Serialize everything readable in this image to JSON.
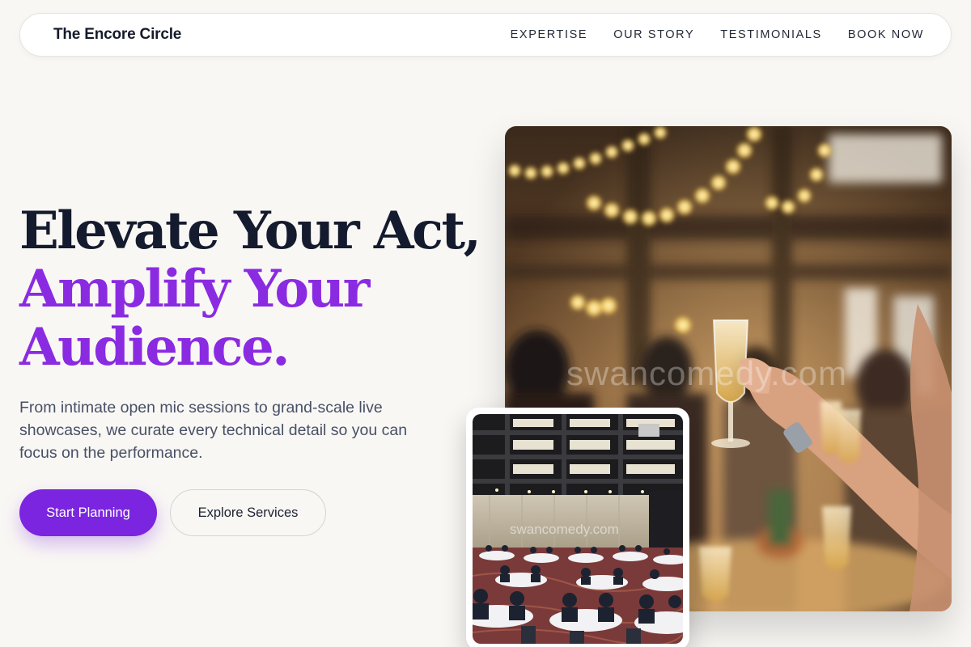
{
  "header": {
    "brand": "The Encore Circle",
    "nav": [
      {
        "label": "EXPERTISE"
      },
      {
        "label": "OUR STORY"
      },
      {
        "label": "TESTIMONIALS"
      },
      {
        "label": "BOOK NOW"
      }
    ]
  },
  "hero": {
    "headline_line1": "Elevate Your Act,",
    "headline_line2": "Amplify Your",
    "headline_line3": "Audience.",
    "subtext": "From intimate open mic sessions to grand-scale live showcases, we curate every technical detail so you can focus on the performance.",
    "primary_button": "Start Planning",
    "secondary_button": "Explore Services"
  },
  "images": {
    "main_watermark": "swancomedy.com",
    "inset_watermark": "swancomedy.com"
  },
  "colors": {
    "accent": "#8a2be2",
    "button_primary": "#7b25e0",
    "headline_dark": "#141b2e",
    "background": "#f9f7f4"
  }
}
